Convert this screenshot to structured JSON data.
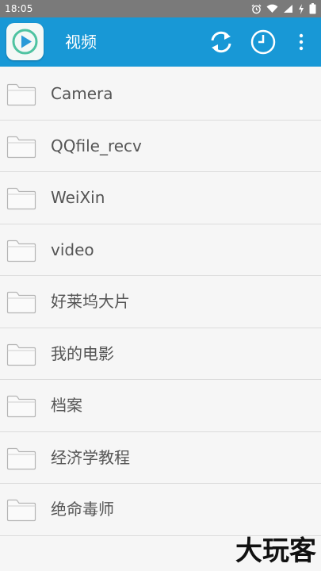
{
  "status_bar": {
    "time": "18:05",
    "icons": [
      "alarm-icon",
      "wifi-icon",
      "signal-icon",
      "charging-icon",
      "battery-icon"
    ]
  },
  "app_bar": {
    "title": "视频",
    "logo_icon": "play-logo-icon",
    "actions": [
      "refresh-icon",
      "history-clock-icon",
      "more-vert-icon"
    ],
    "color": "#1898d6"
  },
  "folders": [
    {
      "name": "Camera"
    },
    {
      "name": "QQfile_recv"
    },
    {
      "name": "WeiXin"
    },
    {
      "name": "video"
    },
    {
      "name": "好莱坞大片"
    },
    {
      "name": "我的电影"
    },
    {
      "name": "档案"
    },
    {
      "name": "经济学教程"
    },
    {
      "name": "绝命毒师"
    }
  ],
  "watermark": "大玩客"
}
